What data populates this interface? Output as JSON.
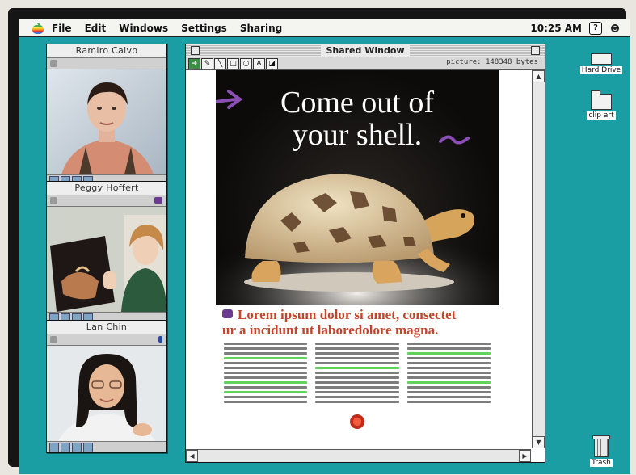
{
  "menubar": {
    "items": [
      "File",
      "Edit",
      "Windows",
      "Settings",
      "Sharing"
    ],
    "time": "10:25 AM",
    "help_glyph": "?"
  },
  "participants": [
    {
      "name": "Ramiro Calvo"
    },
    {
      "name": "Peggy Hoffert"
    },
    {
      "name": "Lan Chin"
    }
  ],
  "shared_window": {
    "title": "Shared Window",
    "info": "picture: 148348 bytes"
  },
  "document": {
    "headline_line1": "Come out of",
    "headline_line2": "your shell.",
    "subhead_line1": "Lorem ipsum dolor si amet, consectet",
    "subhead_line2": "ur a incidunt ut laboredolore magna."
  },
  "desktop_icons": {
    "hard_drive": "Hard Drive",
    "clip_art": "clip art",
    "trash": "Trash"
  },
  "colors": {
    "desktop": "#1a9ea3",
    "headline": "#ffffff",
    "subhead": "#c4452c",
    "highlight": "#5fd35a",
    "annotation": "#8a4fb5"
  }
}
